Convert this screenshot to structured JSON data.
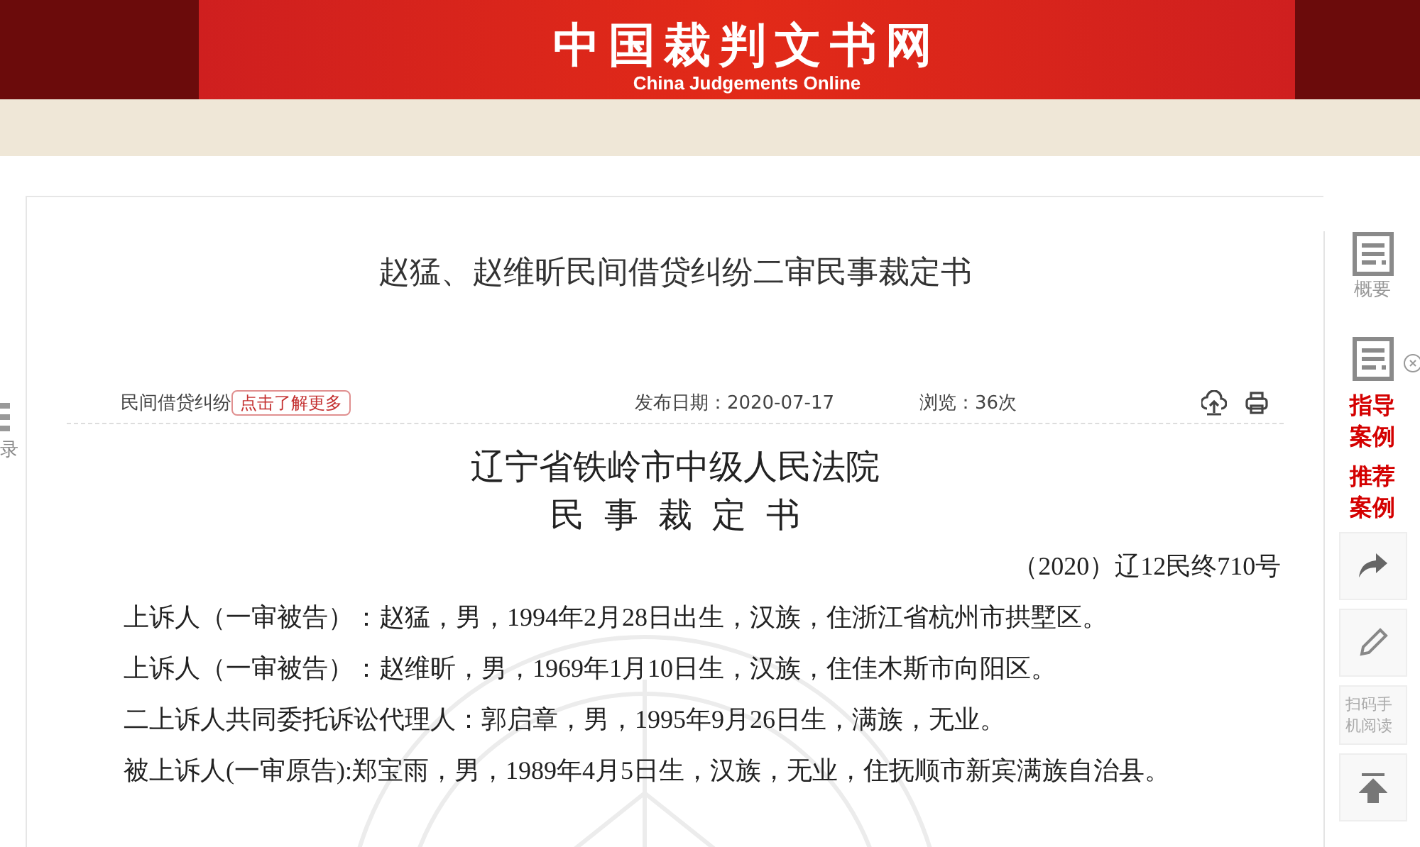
{
  "header": {
    "title": "中国裁判文书网",
    "subtitle": "China Judgements Online"
  },
  "left_tab": {
    "label": "录"
  },
  "document": {
    "title": "赵猛、赵维昕民间借贷纠纷二审民事裁定书",
    "meta": {
      "category": "民间借贷纠纷",
      "more_button": "点击了解更多",
      "publish_date": "发布日期：2020-07-17",
      "views": "浏览：36次"
    },
    "court": "辽宁省铁岭市中级人民法院",
    "doc_type": "民事裁定书",
    "case_number": "（2020）辽12民终710号",
    "paragraphs": [
      "上诉人（一审被告）：赵猛，男，1994年2月28日出生，汉族，住浙江省杭州市拱墅区。",
      "上诉人（一审被告）：赵维昕，男，1969年1月10日生，汉族，住佳木斯市向阳区。",
      "二上诉人共同委托诉讼代理人：郭启章，男，1995年9月26日生，满族，无业。",
      "被上诉人(一审原告):郑宝雨，男，1989年4月5日生，汉族，无业，住抚顺市新宾满族自治县。"
    ]
  },
  "sidebar": {
    "items": [
      {
        "kind": "doc",
        "label": "概要"
      },
      {
        "kind": "doc_close"
      },
      {
        "kind": "link",
        "label": "指导案例"
      },
      {
        "kind": "link",
        "label": "推荐案例"
      },
      {
        "kind": "share"
      },
      {
        "kind": "edit"
      },
      {
        "kind": "text",
        "label": "扫码手机阅读"
      },
      {
        "kind": "top"
      }
    ]
  }
}
